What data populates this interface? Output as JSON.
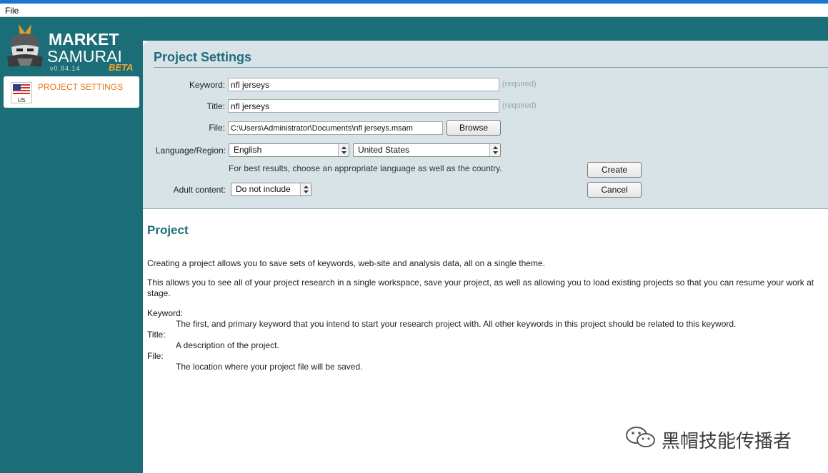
{
  "menubar": {
    "file_label": "File"
  },
  "logo": {
    "line1": "MARKET",
    "line2": "SAMURAI",
    "version": "v0.84.14",
    "badge": "BETA"
  },
  "sidebar": {
    "flag_code": "US",
    "active_item": "PROJECT SETTINGS"
  },
  "settings": {
    "title": "Project Settings",
    "keyword": {
      "label": "Keyword:",
      "value": "nfl jerseys",
      "hint": "(required)"
    },
    "title_field": {
      "label": "Title:",
      "value": "nfl jerseys",
      "hint": "(required)"
    },
    "file": {
      "label": "File:",
      "value": "C:\\Users\\Administrator\\Documents\\nfl jerseys.msam",
      "button": "Browse"
    },
    "language_region": {
      "label": "Language/Region:",
      "language": "English",
      "region": "United States"
    },
    "region_hint": "For best results, choose an appropriate language as well as the country.",
    "adult": {
      "label": "Adult content:",
      "value": "Do not include"
    },
    "create_button": "Create",
    "cancel_button": "Cancel"
  },
  "help": {
    "title": "Project",
    "para1": "Creating a project allows you to save sets of keywords, web-site and analysis data, all on a single theme.",
    "para2_line1": "This allows you to see all of your project research in a single workspace, save your project, as well as allowing you to load existing projects so that you can resume your work at",
    "para2_line2": "stage.",
    "terms": [
      {
        "term": "Keyword:",
        "definition": "The first, and primary keyword that you intend to start your research project with. All other keywords in this project should be related to this keyword."
      },
      {
        "term": "Title:",
        "definition": "A description of the project."
      },
      {
        "term": "File:",
        "definition": "The location where your project file will be saved."
      }
    ]
  },
  "watermark": {
    "text": "黑帽技能传播者"
  },
  "colors": {
    "accent_blue": "#1976d2",
    "sidebar_teal": "#1b6e78",
    "panel_bg": "#d7e3e7",
    "heading_teal": "#1f6c7a",
    "active_orange": "#e07a1c"
  }
}
